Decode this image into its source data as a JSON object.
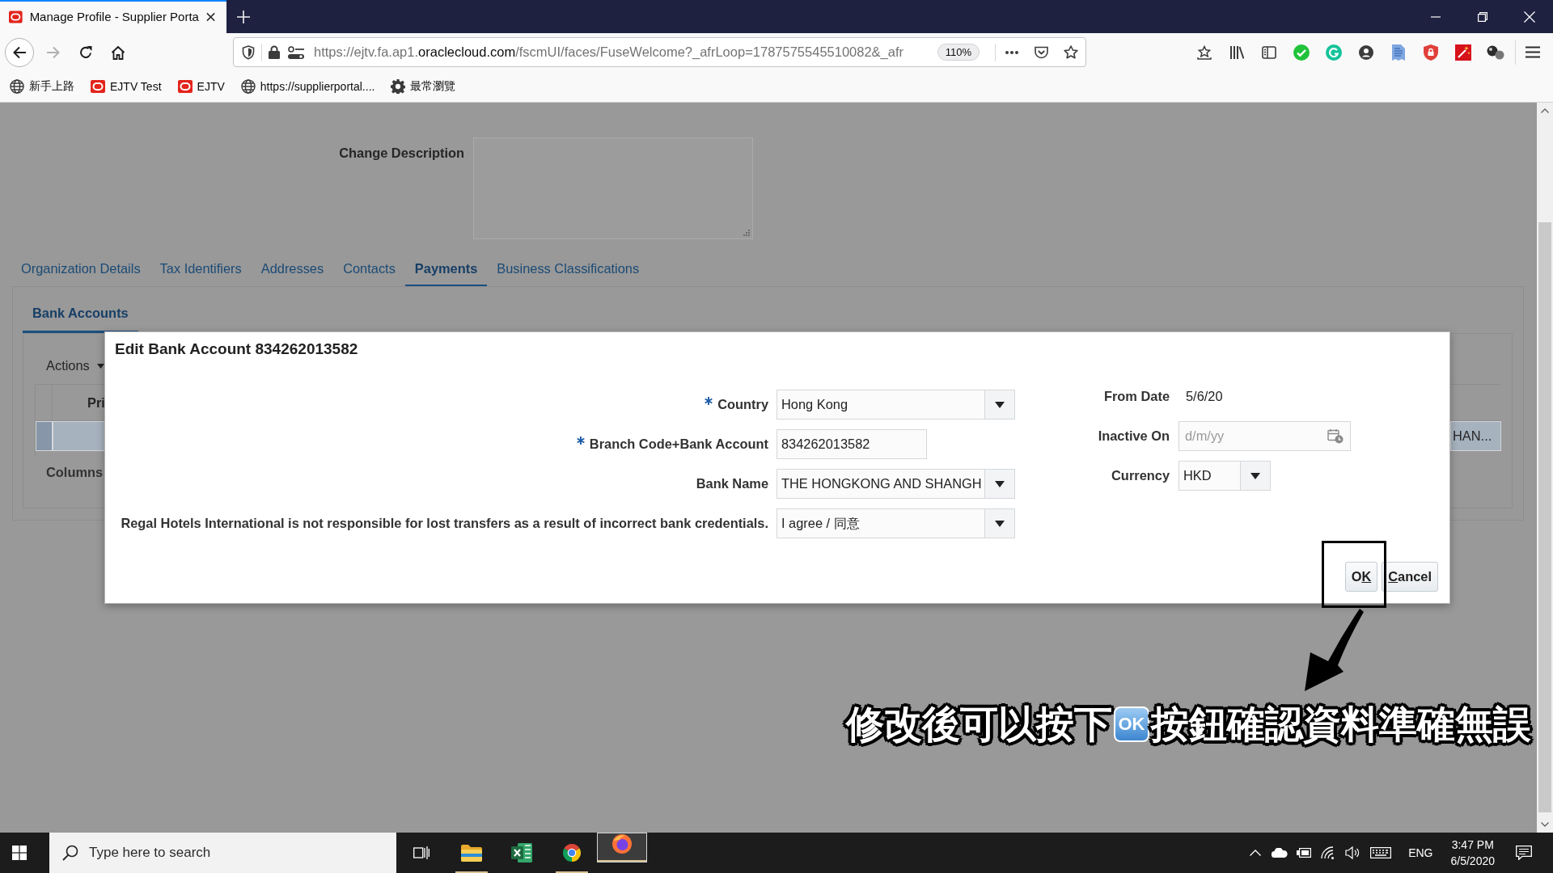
{
  "browser": {
    "tabs": [
      {
        "title": "Manage Profile - Supplier Porta",
        "selected": true
      }
    ],
    "forward_enabled": false,
    "address_bar": {
      "url_start": "https://ejtv.fa.ap1.",
      "url_domain": "oraclecloud.com",
      "url_end": "/fscmUI/faces/FuseWelcome?_afrLoop=1787575545510082&_afr",
      "zoom": "110%"
    },
    "bookmarks": [
      {
        "kind": "globe",
        "label": "新手上路"
      },
      {
        "kind": "logo",
        "label": "EJTV Test"
      },
      {
        "kind": "logo",
        "label": "EJTV"
      },
      {
        "kind": "globe",
        "label": "https://supplierportal...."
      },
      {
        "kind": "gear",
        "label": "最常瀏覽"
      }
    ]
  },
  "page": {
    "change_description": {
      "label": "Change Description"
    },
    "tabs": [
      {
        "label": "Organization Details",
        "selected": false
      },
      {
        "label": "Tax Identifiers",
        "selected": false
      },
      {
        "label": "Addresses",
        "selected": false
      },
      {
        "label": "Contacts",
        "selected": false
      },
      {
        "label": "Payments",
        "selected": true
      },
      {
        "label": "Business Classifications",
        "selected": false
      }
    ],
    "section_tabs": [
      {
        "label": "Bank Accounts",
        "selected": true
      }
    ],
    "table": {
      "actions": "Actions",
      "columns": [
        "Pri"
      ],
      "rows": [
        {
          "selected": true,
          "last_cell": "HAN..."
        }
      ],
      "footer": "Columns"
    }
  },
  "dialog": {
    "title": "Edit Bank Account 834262013582",
    "left_fields": [
      {
        "label": "Country",
        "required": true,
        "kind": "select",
        "value": "Hong Kong"
      },
      {
        "label": "Branch Code+Bank Account",
        "required": true,
        "kind": "text",
        "value": "834262013582"
      },
      {
        "label": "Bank Name",
        "required": false,
        "kind": "select",
        "value": "THE HONGKONG AND SHANGH"
      },
      {
        "label": "Regal Hotels International is not responsible for lost transfers as a result of incorrect bank credentials.",
        "required": false,
        "kind": "select",
        "value": "I agree / 同意"
      }
    ],
    "right_fields": [
      {
        "label": "From Date",
        "kind": "readonly",
        "value": "5/6/20"
      },
      {
        "label": "Inactive On",
        "kind": "date",
        "placeholder": "d/m/yy"
      },
      {
        "label": "Currency",
        "kind": "select",
        "value": "HKD"
      }
    ],
    "buttons": [
      {
        "label_before": "O",
        "mnemonic": "K"
      },
      {
        "mnemonic": "C",
        "label_after": "ancel"
      }
    ]
  },
  "annotation": {
    "before": "修改後可以按下",
    "mark": "OK",
    "after": "按鈕確認資料準確無誤"
  },
  "taskbar": {
    "search": {
      "placeholder": "Type here to search"
    },
    "apps": [
      {
        "kind": "folder",
        "running": true,
        "selected": false
      },
      {
        "kind": "spreadsheet",
        "running": false,
        "selected": false
      },
      {
        "kind": "ring",
        "running": true,
        "selected": false
      },
      {
        "kind": "fox",
        "running": true,
        "selected": true
      }
    ],
    "language": "ENG",
    "time": "3:47 PM",
    "date": "6/5/2020"
  }
}
